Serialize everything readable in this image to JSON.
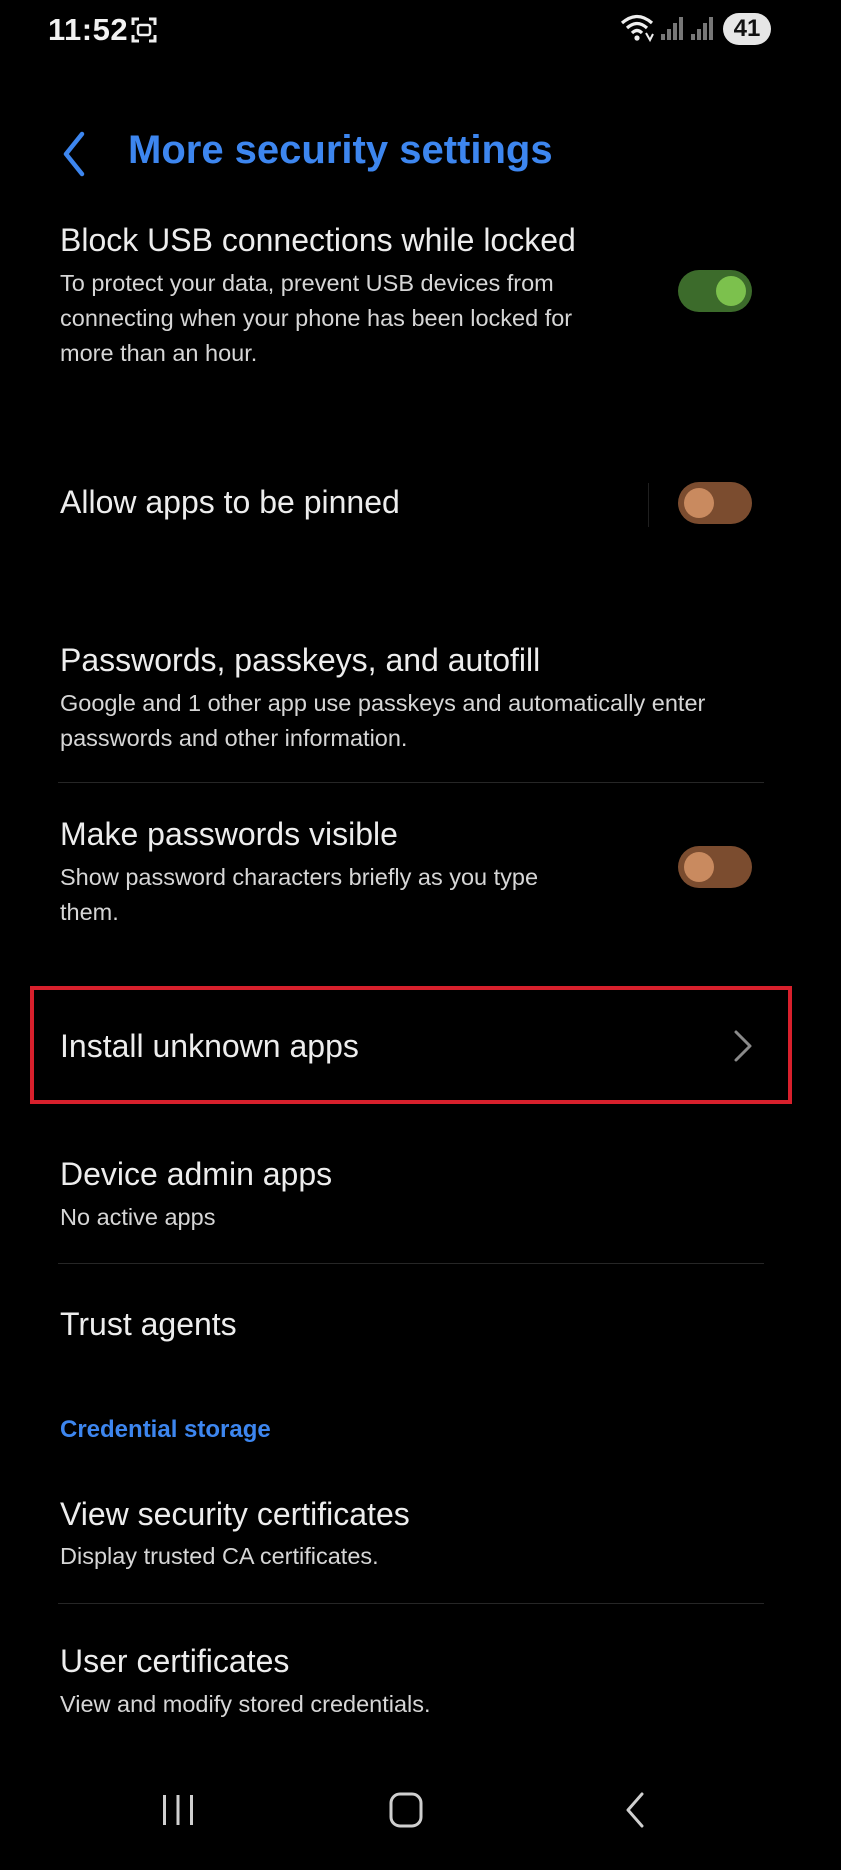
{
  "status_bar": {
    "time": "11:52",
    "battery": "41",
    "icons": [
      "screenshot-icon",
      "wifi-icon",
      "signal-icon",
      "signal-icon"
    ]
  },
  "header": {
    "title": "More security settings",
    "back_icon": "chevron-left-icon"
  },
  "rows": {
    "block_usb": {
      "title": "Block USB connections while locked",
      "subtitle_lines": [
        "To protect your data, prevent USB devices from",
        "connecting when your phone has been locked for",
        "more than an hour."
      ],
      "toggle": "on"
    },
    "pin_apps": {
      "title": "Allow apps to be pinned",
      "toggle": "off"
    },
    "passwords": {
      "title": "Passwords, passkeys, and autofill",
      "subtitle_lines": [
        "Google and 1 other app use passkeys and automatically enter",
        "passwords and other information."
      ]
    },
    "visible_passwords": {
      "title": "Make passwords visible",
      "subtitle_lines": [
        "Show password characters briefly as you type",
        "them."
      ],
      "toggle": "off"
    },
    "install_unknown": {
      "title": "Install unknown apps"
    },
    "device_admin": {
      "title": "Device admin apps",
      "subtitle": "No active apps"
    },
    "trust_agents": {
      "title": "Trust agents"
    },
    "credential_section": "Credential storage",
    "security_certs": {
      "title": "View security certificates",
      "subtitle": "Display trusted CA certificates."
    },
    "user_certs": {
      "title": "User certificates",
      "subtitle": "View and modify stored credentials."
    }
  },
  "colors": {
    "accent": "#3d86ef",
    "toggle_on": "#7cc14d",
    "toggle_off": "#c98a5f",
    "highlight": "#d8202c"
  },
  "nav_bar": [
    "recents-icon",
    "home-icon",
    "back-icon"
  ]
}
